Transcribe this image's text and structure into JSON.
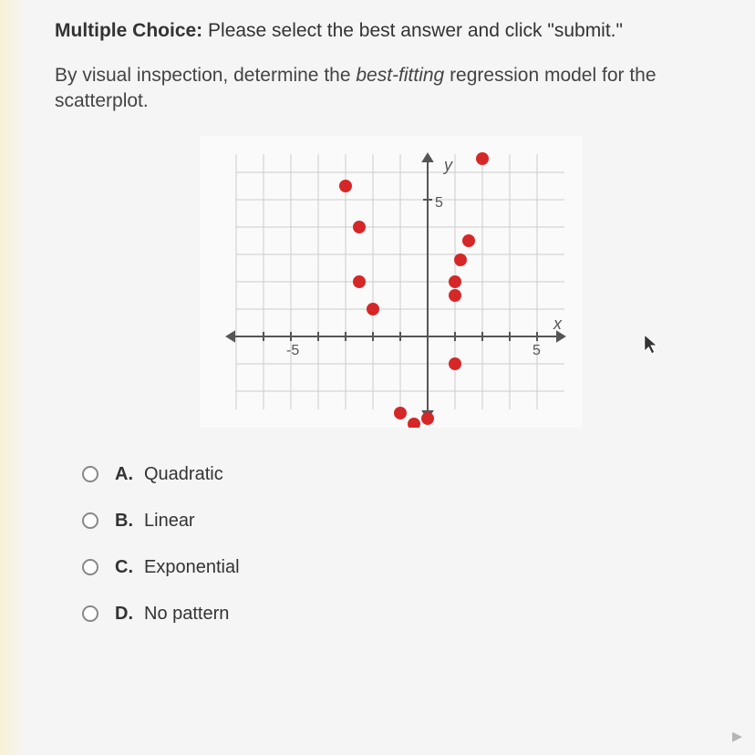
{
  "header": {
    "label": "Multiple Choice:",
    "instruction": "Please select the best answer and click \"submit.\""
  },
  "question": {
    "prefix": "By visual inspection, determine the ",
    "emph": "best-fitting",
    "suffix": " regression model for the scatterplot."
  },
  "chart": {
    "ylabel": "y",
    "xlabel": "x",
    "ytick": "5",
    "xtick_neg": "-5",
    "xtick_pos": "5"
  },
  "chart_data": {
    "type": "scatter",
    "title": "",
    "xlabel": "x",
    "ylabel": "y",
    "xlim": [
      -8,
      8
    ],
    "ylim": [
      -5,
      8
    ],
    "points": [
      {
        "x": -3,
        "y": 5.5
      },
      {
        "x": -2.5,
        "y": 4
      },
      {
        "x": -2.5,
        "y": 2
      },
      {
        "x": -2,
        "y": 1
      },
      {
        "x": -1,
        "y": -2.8
      },
      {
        "x": -0.5,
        "y": -3.2
      },
      {
        "x": 0,
        "y": -3
      },
      {
        "x": 1,
        "y": -1
      },
      {
        "x": 1,
        "y": 1.5
      },
      {
        "x": 1,
        "y": 2
      },
      {
        "x": 1.2,
        "y": 2.8
      },
      {
        "x": 1.5,
        "y": 3.5
      },
      {
        "x": 2,
        "y": 6.5
      }
    ]
  },
  "options": [
    {
      "letter": "A.",
      "text": "Quadratic"
    },
    {
      "letter": "B.",
      "text": "Linear"
    },
    {
      "letter": "C.",
      "text": "Exponential"
    },
    {
      "letter": "D.",
      "text": "No pattern"
    }
  ]
}
